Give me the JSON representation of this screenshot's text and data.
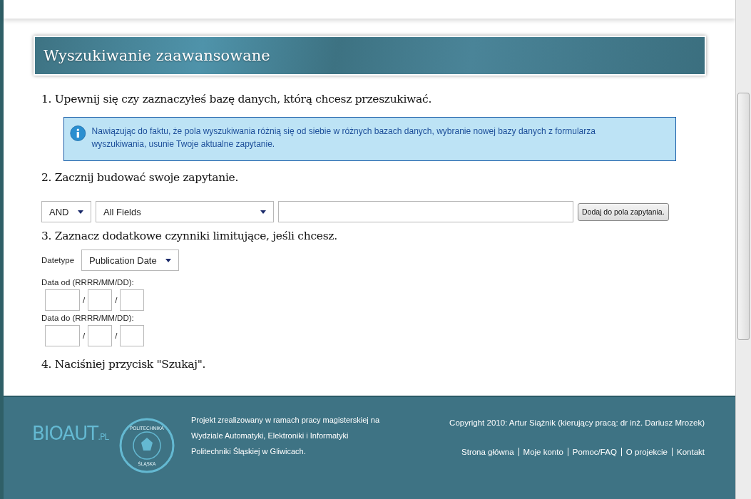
{
  "page_title": "Wyszukiwanie zaawansowane",
  "steps": [
    {
      "heading": "1. Upewnij się czy zaznaczyłeś bazę danych, którą chcesz przeszukiwać."
    },
    {
      "heading": "2. Zacznij budować swoje zapytanie."
    },
    {
      "heading": "3. Zaznacz dodatkowe czynniki limitujące, jeśli chcesz."
    },
    {
      "heading": "4. Naciśniej przycisk \"Szukaj\"."
    }
  ],
  "info_message": "Nawiązując do faktu, że pola wyszukiwania różnią się od siebie w różnych bazach danych, wybranie nowej bazy danych z formularza wyszukiwania, usunie Twoje aktualne zapytanie.",
  "query": {
    "operator": "AND",
    "field": "All Fields",
    "button": "Dodaj do pola zapytania."
  },
  "limits": {
    "datetype_label": "Datetype",
    "datetype": "Publication Date",
    "ranges": [
      {
        "label": "Data od (RRRR/MM/DD):",
        "separators": [
          "/",
          "/"
        ]
      },
      {
        "label": "Data do (RRRR/MM/DD):",
        "separators": [
          "/",
          "/"
        ]
      }
    ]
  },
  "footer": {
    "logo": "BIOAUT",
    "logo_suffix": ".PL",
    "seal_top": "POLITECHNIKA",
    "seal_bottom": "ŚLĄSKA",
    "about": [
      "Projekt zrealizowany w ramach pracy magisterskiej na",
      "Wydziale Automatyki, Elektroniki i Informatyki",
      "Politechniki Śląskiej w Gliwicach."
    ],
    "copyright": "Copyright 2010: Artur Siążnik (kierujący pracą: dr inż. Dariusz Mrozek)",
    "links": [
      "Strona główna",
      "Moje konto",
      "Pomoc/FAQ",
      "O projekcie",
      "Kontakt"
    ]
  }
}
